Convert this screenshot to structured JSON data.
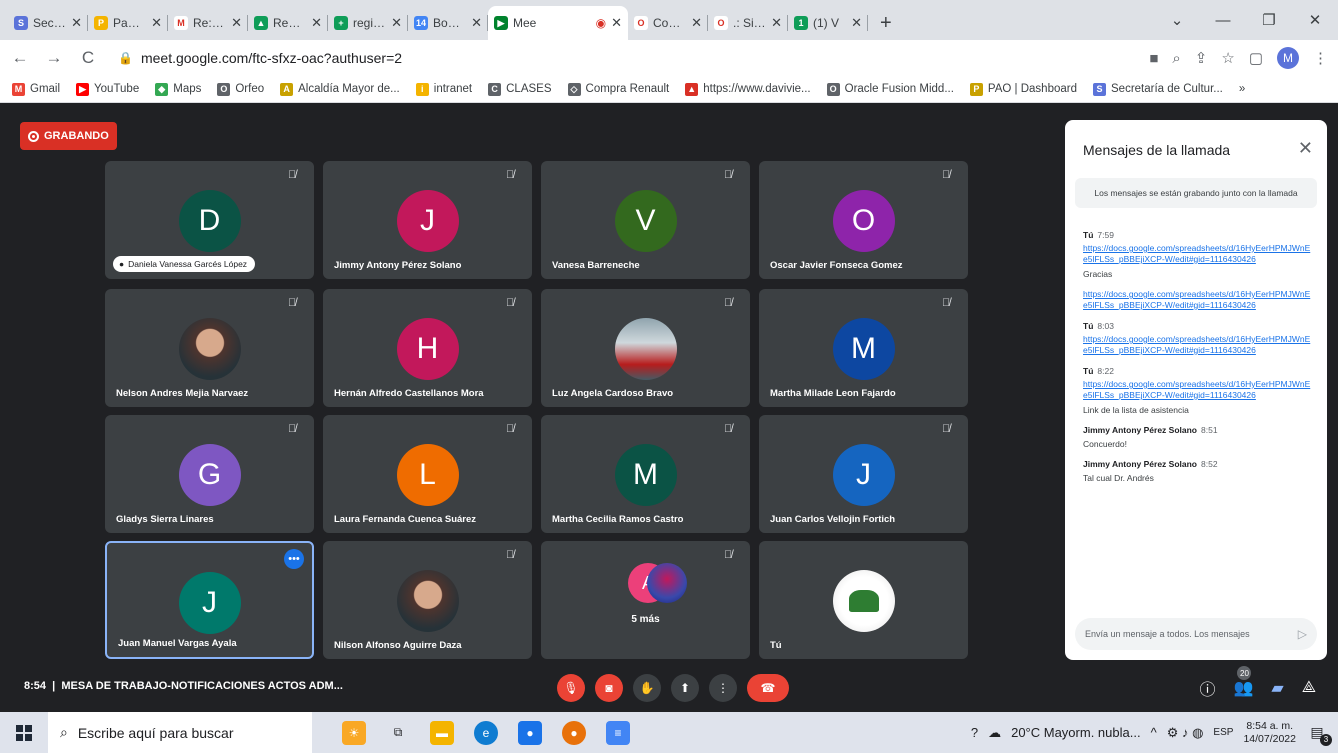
{
  "browser": {
    "tabs": [
      {
        "title": "Secretar",
        "favicon_color": "#5b73d9",
        "favicon": "S"
      },
      {
        "title": "Pagina p",
        "favicon_color": "#f4b400",
        "favicon": "P"
      },
      {
        "title": "Re: PRO",
        "favicon_color": "#ffffff",
        "favicon": "M"
      },
      {
        "title": "Reciente",
        "favicon_color": "#0f9d58",
        "favicon": "▲"
      },
      {
        "title": "registro",
        "favicon_color": "#0f9d58",
        "favicon": "+"
      },
      {
        "title": "Bogotá",
        "favicon_color": "#4285f4",
        "favicon": "14"
      },
      {
        "title": "Mee",
        "favicon_color": "#00832d",
        "favicon": "▶",
        "active": true
      },
      {
        "title": "Contenic",
        "favicon_color": "#ffffff",
        "favicon": "O"
      },
      {
        "title": ".: Sisten",
        "favicon_color": "#ffffff",
        "favicon": "O"
      },
      {
        "title": "(1) V",
        "favicon_color": "#0f9d58",
        "favicon": "1"
      }
    ],
    "url": "meet.google.com/ftc-sfxz-oac?authuser=2",
    "profile_initial": "M",
    "bookmarks": [
      {
        "label": "Gmail",
        "color": "#ea4335",
        "icon": "M"
      },
      {
        "label": "YouTube",
        "color": "#ff0000",
        "icon": "▶"
      },
      {
        "label": "Maps",
        "color": "#34a853",
        "icon": "◆"
      },
      {
        "label": "Orfeo",
        "color": "#5f6368",
        "icon": "O"
      },
      {
        "label": "Alcaldía Mayor de...",
        "color": "#c8a100",
        "icon": "A"
      },
      {
        "label": "intranet",
        "color": "#f4b400",
        "icon": "i"
      },
      {
        "label": "CLASES",
        "color": "#5f6368",
        "icon": "C"
      },
      {
        "label": "Compra Renault",
        "color": "#5f6368",
        "icon": "◇"
      },
      {
        "label": "https://www.davivie...",
        "color": "#d93025",
        "icon": "▲"
      },
      {
        "label": "Oracle Fusion Midd...",
        "color": "#5f6368",
        "icon": "O"
      },
      {
        "label": "PAO | Dashboard",
        "color": "#c8a100",
        "icon": "P"
      },
      {
        "label": "Secretaría de Cultur...",
        "color": "#5b73d9",
        "icon": "S"
      }
    ]
  },
  "meet": {
    "recording_label": "GRABANDO",
    "participants": [
      {
        "name": "Daniela Vanessa Garcés López",
        "initial": "D",
        "color": "#0b5345",
        "pill": true
      },
      {
        "name": "Jimmy Antony Pérez Solano",
        "initial": "J",
        "color": "#c2185b"
      },
      {
        "name": "Vanesa Barreneche",
        "initial": "V",
        "color": "#33691e"
      },
      {
        "name": "Oscar Javier Fonseca Gomez",
        "initial": "O",
        "color": "#8e24aa"
      },
      {
        "name": "Nelson Andres Mejia Narvaez",
        "initial": "",
        "color": "#6d4c41",
        "photo": true
      },
      {
        "name": "Hernán Alfredo Castellanos Mora",
        "initial": "H",
        "color": "#c2185b"
      },
      {
        "name": "Luz Angela Cardoso Bravo",
        "initial": "",
        "color": "#607d8b",
        "photo": true
      },
      {
        "name": "Martha Milade Leon Fajardo",
        "initial": "M",
        "color": "#0d47a1"
      },
      {
        "name": "Gladys Sierra Linares",
        "initial": "G",
        "color": "#7e57c2"
      },
      {
        "name": "Laura Fernanda Cuenca Suárez",
        "initial": "L",
        "color": "#ef6c00"
      },
      {
        "name": "Martha Cecilia Ramos Castro",
        "initial": "M",
        "color": "#0b5345"
      },
      {
        "name": "Juan Carlos Vellojin Fortich",
        "initial": "J",
        "color": "#1565c0"
      },
      {
        "name": "Juan Manuel Vargas Ayala",
        "initial": "J",
        "color": "#00796b",
        "selected": true
      },
      {
        "name": "Nilson Alfonso Aguirre Daza",
        "initial": "",
        "color": "#455a64",
        "photo": true
      },
      {
        "name": "",
        "initial": "A",
        "color": "#ec407a",
        "more": "5 más"
      },
      {
        "name": "Tú",
        "initial": "",
        "color": "#ffffff",
        "photo": true
      }
    ],
    "chat": {
      "title": "Mensajes de la llamada",
      "notice": "Los mensajes se están grabando junto con la llamada",
      "messages": [
        {
          "sender": "Tú",
          "time": "7:59",
          "link": "https://docs.google.com/spreadsheets/d/16HyEerHPMJWnEe5lFLSs_pBBEjiXCP-W/edit#gid=1116430426",
          "text": "Gracias"
        },
        {
          "sender": "",
          "time": "",
          "link": "https://docs.google.com/spreadsheets/d/16HyEerHPMJWnEe5lFLSs_pBBEjiXCP-W/edit#gid=1116430426",
          "text": ""
        },
        {
          "sender": "Tú",
          "time": "8:03",
          "link": "https://docs.google.com/spreadsheets/d/16HyEerHPMJWnEe5lFLSs_pBBEjiXCP-W/edit#gid=1116430426",
          "text": ""
        },
        {
          "sender": "Tú",
          "time": "8:22",
          "link": "https://docs.google.com/spreadsheets/d/16HyEerHPMJWnEe5lFLSs_pBBEjiXCP-W/edit#gid=1116430426",
          "text": "Link de la lista de asistencia"
        },
        {
          "sender": "Jimmy Antony Pérez Solano",
          "time": "8:51",
          "link": "",
          "text": "Concuerdo!"
        },
        {
          "sender": "Jimmy Antony Pérez Solano",
          "time": "8:52",
          "link": "",
          "text": "Tal cual Dr. Andrés"
        }
      ],
      "input_placeholder": "Envía un mensaje a todos. Los mensajes"
    },
    "bottom": {
      "time": "8:54",
      "meeting_title": "MESA DE TRABAJO-NOTIFICACIONES ACTOS ADM...",
      "people_count": "20"
    }
  },
  "taskbar": {
    "search_placeholder": "Escribe aquí para buscar",
    "weather": "20°C  Mayorm. nubla...",
    "lang": "ESP",
    "clock_time": "8:54 a. m.",
    "clock_date": "14/07/2022",
    "notif_count": "3"
  }
}
